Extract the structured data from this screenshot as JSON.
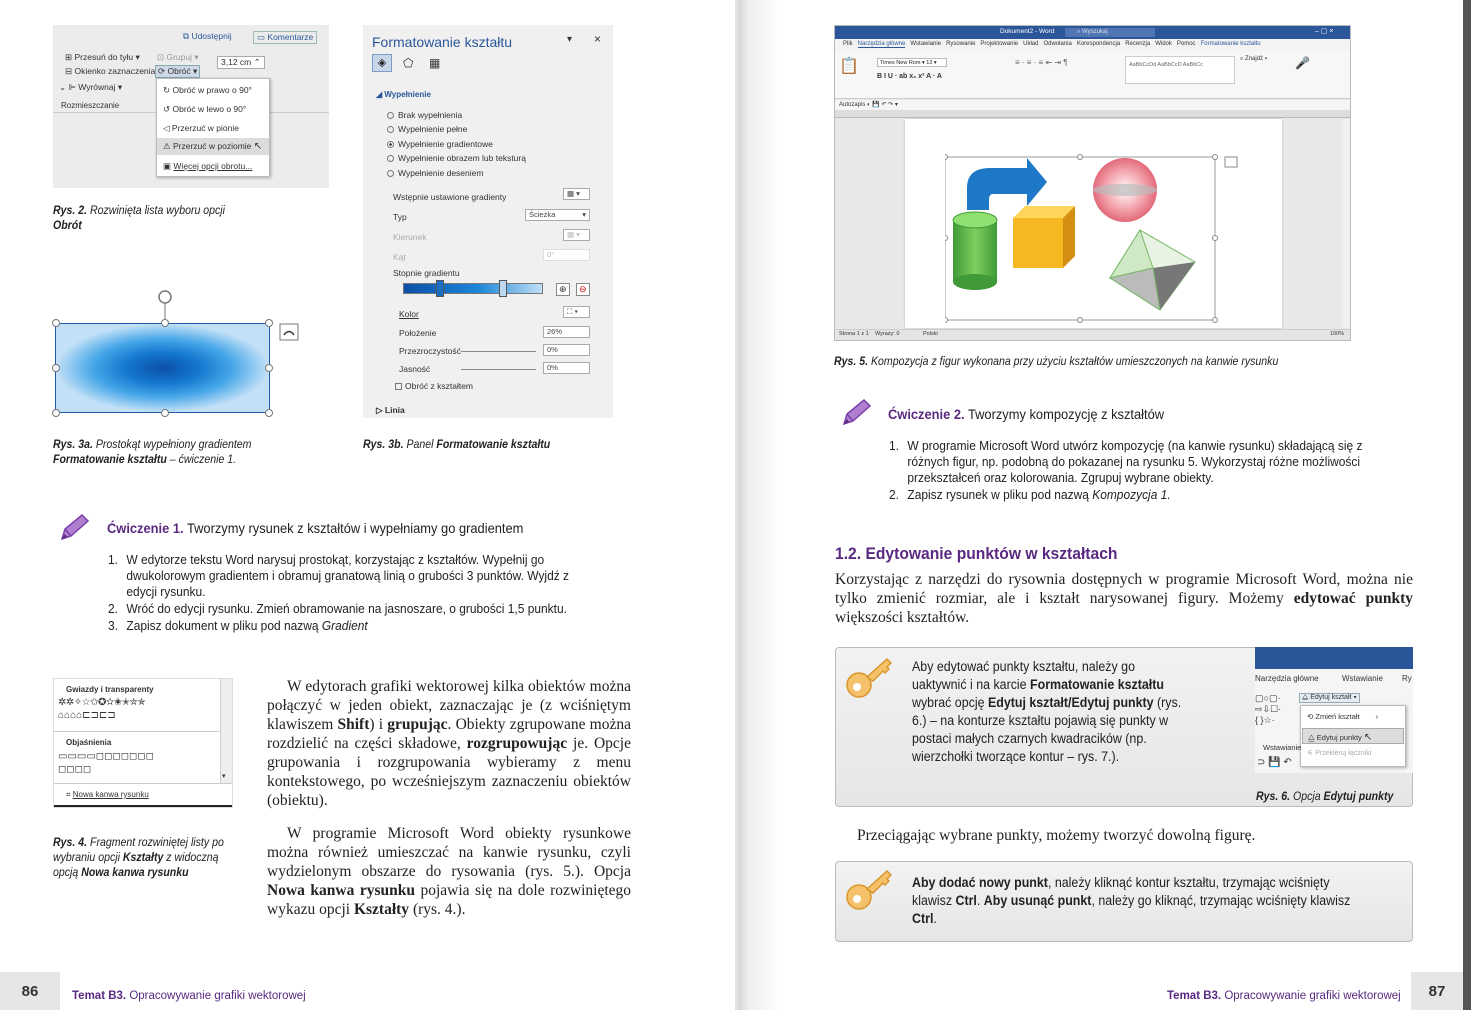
{
  "left": {
    "fig2": {
      "share": "Udostępnij",
      "comments": "Komentarze",
      "move_back": "Przesuń do tyłu",
      "selection_pane": "Okienko zaznaczenia",
      "align": "Wyrównaj",
      "group": "Grupuj",
      "rotate": "Obróć",
      "arrange": "Rozmieszczanie",
      "size": "3,12 cm",
      "menu": [
        "Obróć w prawo o 90°",
        "Obróć w lewo o 90°",
        "Przerzuć w pionie",
        "Przerzuć w poziomie",
        "Więcej opcji obrotu..."
      ],
      "caption_label": "Rys. 2.",
      "caption_text": "Rozwinięta lista wyboru opcji",
      "caption_bold": "Obrót"
    },
    "fig3a": {
      "caption_label": "Rys. 3a.",
      "caption_text": "Prostokąt wypełniony gradientem",
      "caption_bold": "Formatowanie kształtu",
      "caption_tail": "– ćwiczenie 1."
    },
    "fig3b": {
      "panel_title": "Formatowanie kształtu",
      "section_fill": "Wypełnienie",
      "options": [
        "Brak wypełnienia",
        "Wypełnienie pełne",
        "Wypełnienie gradientowe",
        "Wypełnienie obrazem lub teksturą",
        "Wypełnienie deseniem"
      ],
      "preset": "Wstępnie ustawione gradienty",
      "type_label": "Typ",
      "type_value": "Ścieżka",
      "direction": "Kierunek",
      "angle": "Kąt",
      "angle_value": "0°",
      "stops": "Stopnie gradientu",
      "color": "Kolor",
      "position": "Położenie",
      "position_value": "26%",
      "transparency": "Przezroczystość",
      "transparency_value": "0%",
      "brightness": "Jasność",
      "brightness_value": "0%",
      "rotate_with": "Obróć z kształtem",
      "line": "Linia",
      "caption_label": "Rys. 3b.",
      "caption_text": "Panel",
      "caption_bold": "Formatowanie kształtu"
    },
    "exercise1": {
      "label": "Ćwiczenie 1.",
      "title": "Tworzymy rysunek z kształtów i wypełniamy go gradientem",
      "items": [
        "W edytorze tekstu Word narysuj prostokąt, korzystając z kształtów. Wypełnij go dwukolorowym gradientem i obramuj granatową linią o grubości 3 punktów. Wyjdź z edycji rysunku.",
        "Wróć do edycji rysunku. Zmień obramowanie na jasnoszare, o grubości 1,5 punktu.",
        "Zapisz dokument w pliku pod nazwą"
      ],
      "item3_italic": "Gradient"
    },
    "fig4": {
      "sec1": "Gwiazdy i transparenty",
      "sec2": "Objaśnienia",
      "new_canvas": "Nowa kanwa rysunku",
      "caption_label": "Rys. 4.",
      "caption_text": "Fragment rozwiniętej listy po wybraniu opcji",
      "caption_bold1": "Kształty",
      "caption_mid": "z widoczną opcją",
      "caption_bold2": "Nowa kanwa rysunku"
    },
    "para1": {
      "t1": "W edytorach grafiki wektorowej kilka obiektów można połączyć w jeden obiekt, zaznaczając je (z wciśniętym klawiszem ",
      "b1": "Shift",
      "t2": ") i ",
      "b2": "grupując",
      "t3": ". Obiekty zgrupowane można rozdzielić na części składowe, ",
      "b3": "rozgrupowując",
      "t4": " je. Opcje grupowania i rozgrupowania wybieramy z menu kontekstowego, po wcześniejszym zaznaczeniu obiektów (obiektu)."
    },
    "para2": {
      "t1": "W programie Microsoft Word obiekty rysunkowe można również umieszczać na kanwie rysunku, czyli wydzielonym obszarze do rysowania (rys. 5.). Opcja ",
      "b1": "Nowa kanwa rysunku",
      "t2": " pojawia się na dole rozwiniętego wykazu opcji ",
      "b2": "Kształty",
      "t3": " (rys. 4.)."
    },
    "page_number": "86",
    "footer_bold": "Temat B3.",
    "footer_text": "Opracowywanie grafiki wektorowej"
  },
  "right": {
    "fig5": {
      "window_title": "Dokument2 - Word",
      "search": "Wyszukaj",
      "menu": [
        "Plik",
        "Narzędzia główne",
        "Wstawianie",
        "Rysowanie",
        "Projektowanie",
        "Układ",
        "Odwołania",
        "Korespondencja",
        "Recenzja",
        "Widok",
        "Pomoc",
        "Formatowanie kształtu"
      ],
      "status_left": "Strona 1 z 1",
      "status_words": "Wyrazy: 0",
      "status_lang": "Polski",
      "zoom": "100%",
      "caption_label": "Rys. 5.",
      "caption_text": "Kompozycja z figur wykonana przy użyciu kształtów umieszczonych na kanwie rysunku"
    },
    "exercise2": {
      "label": "Ćwiczenie 2.",
      "title": "Tworzymy kompozycję z kształtów",
      "items": [
        "W programie Microsoft Word utwórz kompozycję (na kanwie rysunku) składającą się z różnych figur, np. podobną do pokazanej na rysunku 5. Wykorzystaj różne możliwości przekształceń oraz kolorowania. Zgrupuj wybrane obiekty.",
        "Zapisz rysunek w pliku pod nazwą"
      ],
      "item2_italic": "Kompozycja 1."
    },
    "section": {
      "number": "1.2.",
      "title": "Edytowanie punktów w kształtach"
    },
    "para1": {
      "t1": "Korzystając z narzędzi do rysownia dostępnych w programie Microsoft Word, można nie tylko zmienić rozmiar, ale i kształt narysowanej figury. Możemy ",
      "b1": "edytować punkty",
      "t2": " większości kształtów."
    },
    "tip1": {
      "t1": "Aby edytować punkty kształtu, należy go uaktywnić i na karcie ",
      "b1": "Formatowanie kształtu",
      "t2": " wybrać opcję ",
      "b2": "Edytuj kształt/Edytuj punkty",
      "t3": " (rys. 6.) – na konturze kształtu pojawią się punkty w postaci małych czarnych kwadracików (np. wierzchołki tworzące kontur – rys. 7.)."
    },
    "fig6": {
      "tab1": "Narzędzia główne",
      "tab2": "Wstawianie",
      "tab3": "Ry",
      "edit_shape": "Edytuj kształt",
      "change_shape": "Zmień kształt",
      "edit_points": "Edytuj punkty",
      "reroute": "Przekieruj łączniki",
      "tab4": "Wstawianie",
      "caption_label": "Rys. 6.",
      "caption_text": "Opcja",
      "caption_bold": "Edytuj punkty"
    },
    "para2": "Przeciągając wybrane punkty, możemy tworzyć dowolną figurę.",
    "tip2": {
      "b1": "Aby dodać nowy punkt",
      "t1": ", należy kliknąć kontur kształtu, trzymając wciśnięty klawisz ",
      "b2": "Ctrl",
      "t2": ". ",
      "b3": "Aby usunąć punkt",
      "t3": ", należy go kliknąć, trzymając wciśnięty klawisz ",
      "b4": "Ctrl",
      "t4": "."
    },
    "page_number": "87",
    "footer_bold": "Temat B3.",
    "footer_text": "Opracowywanie grafiki wektorowej"
  },
  "colors": {
    "accent_purple": "#5a2a82",
    "word_blue": "#2b579a",
    "gradient_blue": "#1e88d8"
  }
}
